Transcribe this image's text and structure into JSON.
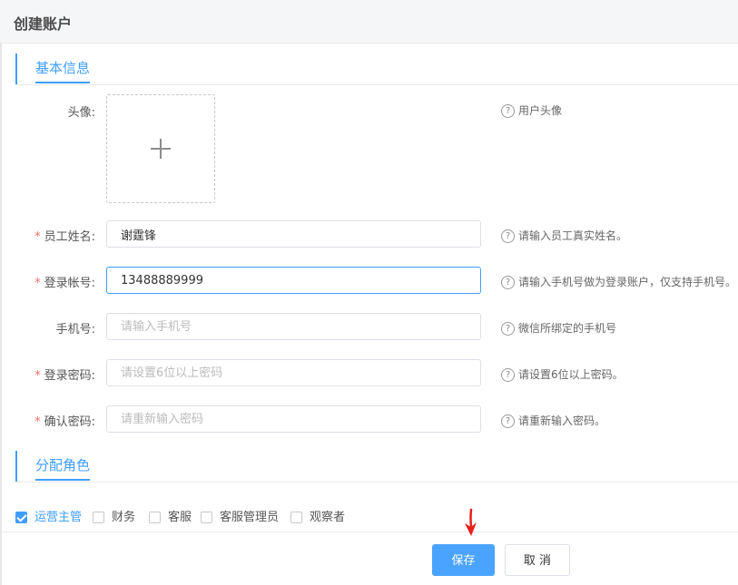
{
  "dialog": {
    "title": "创建账户"
  },
  "section_basic": {
    "title": "基本信息"
  },
  "section_roles": {
    "title": "分配角色"
  },
  "fields": {
    "avatar": {
      "label": "头像:",
      "hint": "用户头像"
    },
    "name": {
      "label": "员工姓名:",
      "value": "谢霆锋",
      "placeholder": "",
      "hint": "请输入员工真实姓名。",
      "required": "*"
    },
    "account": {
      "label": "登录帐号:",
      "value": "13488889999",
      "placeholder": "",
      "hint": "请输入手机号做为登录账户，仅支持手机号。",
      "required": "*"
    },
    "phone": {
      "label": "手机号:",
      "value": "",
      "placeholder": "请输入手机号",
      "hint": "微信所绑定的手机号"
    },
    "password": {
      "label": "登录密码:",
      "value": "",
      "placeholder": "请设置6位以上密码",
      "hint": "请设置6位以上密码。",
      "required": "*"
    },
    "confirm": {
      "label": "确认密码:",
      "value": "",
      "placeholder": "请重新输入密码",
      "hint": "请重新输入密码。",
      "required": "*"
    }
  },
  "hint_icon": "?",
  "roles": [
    {
      "label": "运营主管",
      "checked": true
    },
    {
      "label": "财务",
      "checked": false
    },
    {
      "label": "客服",
      "checked": false
    },
    {
      "label": "客服管理员",
      "checked": false
    },
    {
      "label": "观察者",
      "checked": false
    }
  ],
  "buttons": {
    "save": "保存",
    "cancel": "取 消"
  },
  "colors": {
    "accent": "#409eff",
    "required": "#f56c6c",
    "annotation_arrow": "#e8211c"
  },
  "icons": {
    "upload": "plus-icon",
    "hint": "question-circle-icon",
    "annotation": "red-arrow-down-icon"
  }
}
